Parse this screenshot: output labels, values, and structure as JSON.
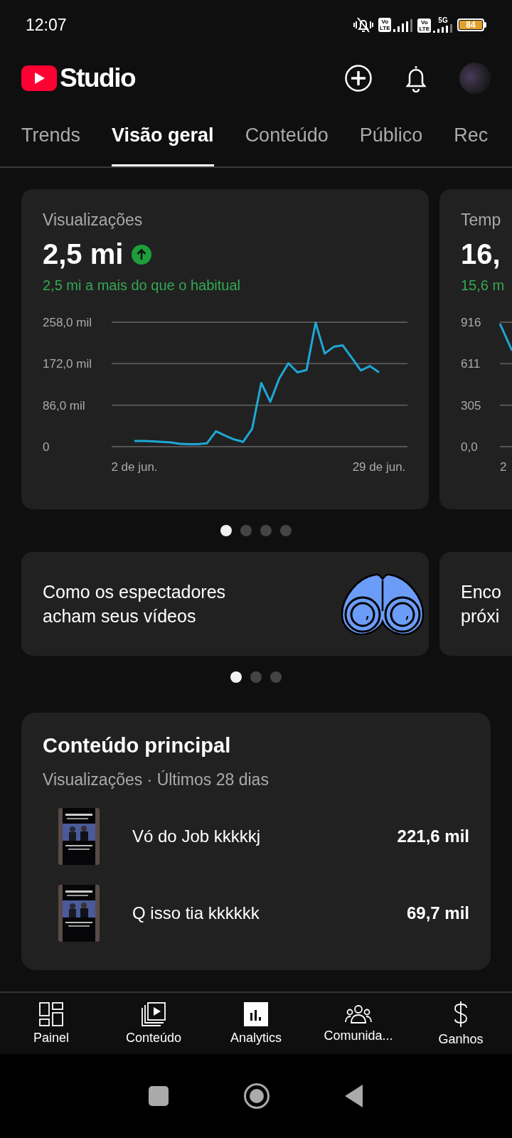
{
  "status_bar": {
    "time": "12:07",
    "sims": [
      {
        "top": "Vo",
        "bottom": "LTE"
      },
      {
        "top": "Vo",
        "bottom": "LTE",
        "network": "5G"
      }
    ],
    "battery": "84"
  },
  "header": {
    "logo_text": "Studio"
  },
  "tabs": [
    {
      "label": "Trends",
      "selected": false
    },
    {
      "label": "Visão geral",
      "selected": true
    },
    {
      "label": "Conteúdo",
      "selected": false
    },
    {
      "label": "Público",
      "selected": false
    },
    {
      "label": "Rec",
      "selected": false
    }
  ],
  "metric_cards": [
    {
      "title": "Visualizações",
      "value": "2,5 mi",
      "trend_up": true,
      "delta": "2,5 mi a mais do que o habitual",
      "peek": false,
      "chart_data": {
        "type": "line",
        "series": [
          {
            "color": "#1fa8d6",
            "values": [
              12,
              12,
              11,
              10,
              9,
              6,
              5,
              5,
              7,
              32,
              23,
              15,
              10,
              37,
              132,
              93,
              142,
              173,
              154,
              159,
              257,
              193,
              207,
              210,
              184,
              158,
              167,
              154
            ]
          }
        ],
        "categories": [
          "2 de jun.",
          null,
          null,
          null,
          null,
          null,
          null,
          null,
          null,
          null,
          null,
          null,
          null,
          null,
          null,
          null,
          null,
          null,
          null,
          null,
          null,
          null,
          null,
          null,
          null,
          null,
          null,
          "29 de jun."
        ],
        "ylim": [
          0,
          258
        ],
        "yticks": [
          {
            "value": 0,
            "label": "0"
          },
          {
            "value": 86,
            "label": "86,0 mil"
          },
          {
            "value": 172,
            "label": "172,0 mil"
          },
          {
            "value": 258,
            "label": "258,0 mil"
          }
        ]
      }
    },
    {
      "title": "Temp",
      "value": "16,",
      "trend_up": true,
      "delta": "15,6 m",
      "peek": true,
      "axis_labels": [
        "916",
        "611",
        "305",
        "0,0"
      ],
      "date_label": "2"
    }
  ],
  "metric_pager": [
    {
      "selected": true
    },
    {
      "selected": false
    },
    {
      "selected": false
    },
    {
      "selected": false
    }
  ],
  "insight_cards": [
    {
      "title": "Como os espectadores acham seus vídeos",
      "peek": false,
      "kind": "binoculars"
    },
    {
      "title": "Enco próxi",
      "peek": true,
      "kind": "text"
    }
  ],
  "insight_pager": [
    {
      "selected": true
    },
    {
      "selected": false
    },
    {
      "selected": false
    }
  ],
  "top_content": {
    "title": "Conteúdo principal",
    "subtitle": "Visualizações · Últimos 28 dias",
    "rows": [
      {
        "kind": "picture",
        "title": "Vó do Job kkkkkj",
        "views": "221,6 mil"
      },
      {
        "kind": "picture",
        "title": "Q isso tia kkkkkk",
        "views": "69,7 mil"
      }
    ]
  },
  "bottom_nav": [
    {
      "kind": "dashboard",
      "label": "Painel",
      "selected": false
    },
    {
      "kind": "content",
      "label": "Conteúdo",
      "selected": false
    },
    {
      "kind": "analytics",
      "label": "Analytics",
      "selected": true
    },
    {
      "kind": "community",
      "label": "Comunida...",
      "selected": false
    },
    {
      "kind": "earnings",
      "label": "Ganhos",
      "selected": false
    }
  ]
}
